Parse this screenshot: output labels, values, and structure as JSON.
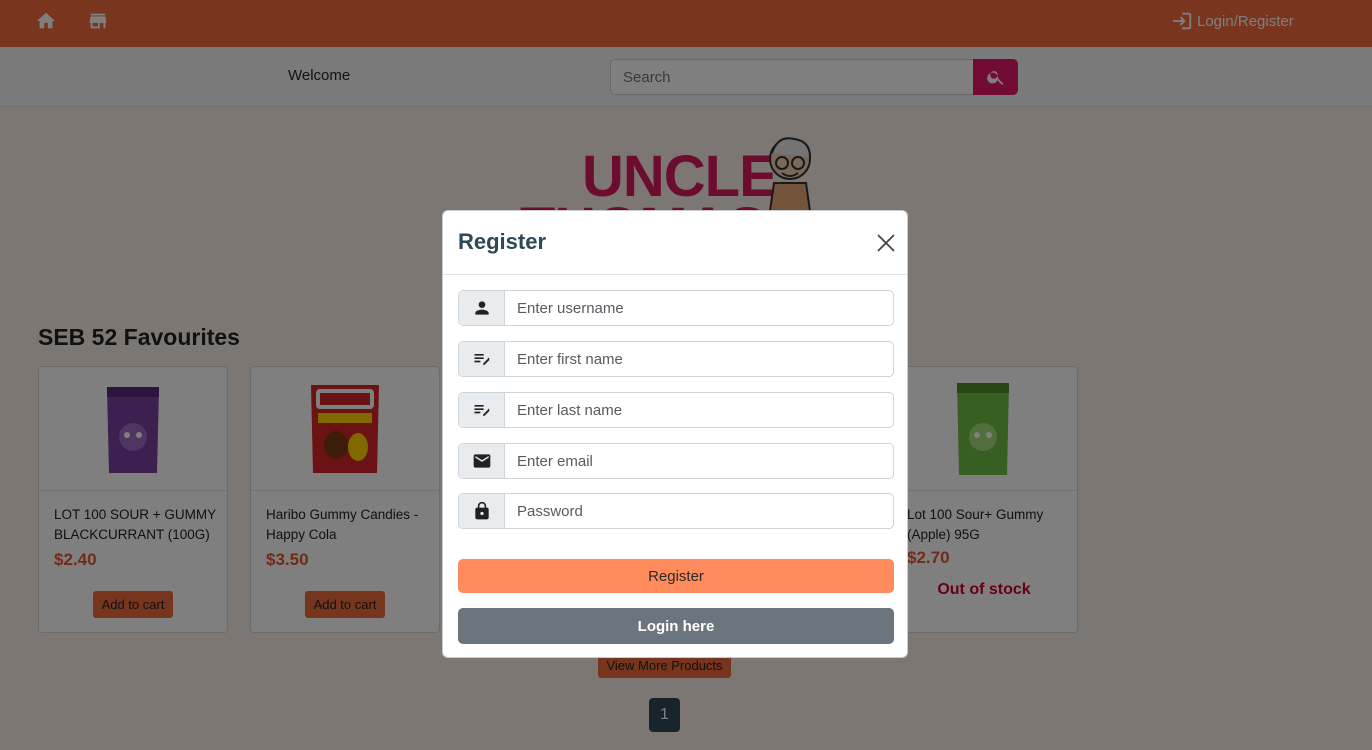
{
  "topbar": {
    "login_label": "Login/Register",
    "icons": [
      "home-icon",
      "store-icon",
      "login-icon"
    ]
  },
  "subbar": {
    "welcome": "Welcome",
    "search_placeholder": "Search"
  },
  "logo": {
    "line1": "UNCLE",
    "line2": "THOMAS"
  },
  "section": {
    "title": "SEB 52 Favourites"
  },
  "products": [
    {
      "name": "LOT 100 SOUR + GUMMY BLACKCURRANT (100G)",
      "price": "$2.40",
      "action": "Add to cart"
    },
    {
      "name": "Haribo Gummy Candies - Happy Cola",
      "price": "$3.50",
      "action": "Add to cart"
    },
    {
      "name": "Lot 100 Sour+ Gummy (Apple) 95G",
      "price": "$2.70",
      "status": "Out of stock"
    }
  ],
  "view_more_label": "View More Products",
  "pagination": {
    "current": "1"
  },
  "modal": {
    "title": "Register",
    "fields": {
      "username_placeholder": "Enter username",
      "first_name_placeholder": "Enter first name",
      "last_name_placeholder": "Enter last name",
      "email_placeholder": "Enter email",
      "password_placeholder": "Password"
    },
    "register_label": "Register",
    "login_label": "Login here"
  },
  "colors": {
    "brand_orange": "#f26b3a",
    "accent_pink": "#e5176a",
    "register_button": "#ff8a5c",
    "login_button": "#6c757d",
    "price": "#e4572e",
    "out_of_stock": "#d0002a"
  }
}
